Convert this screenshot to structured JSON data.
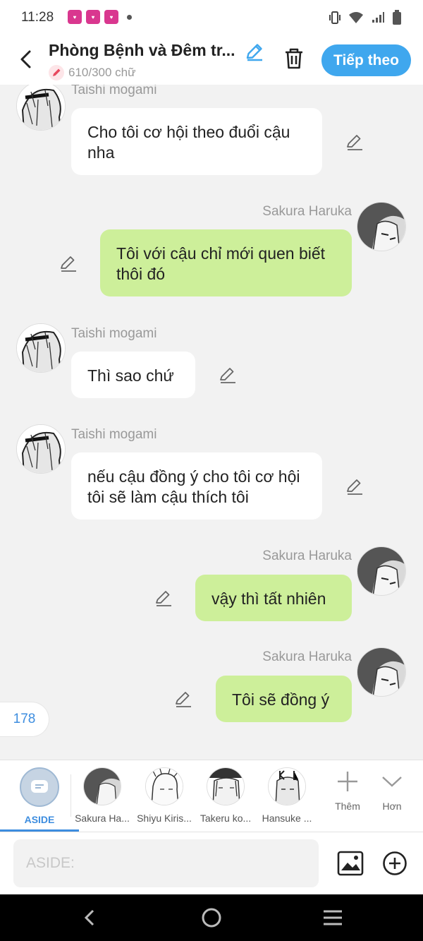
{
  "status_bar": {
    "time": "11:28",
    "notification_icons": [
      "app-notification-icon",
      "app-notification-icon",
      "app-notification-icon"
    ],
    "system_icons": [
      "vibrate-icon",
      "wifi-icon",
      "signal-icon",
      "battery-icon"
    ]
  },
  "header": {
    "title": "Phòng Bệnh và Đêm tr...",
    "word_count": "610/300 chữ",
    "next_label": "Tiếp theo",
    "accent_color": "#3fa7ee"
  },
  "messages": [
    {
      "sender": "Taishi mogami",
      "side": "left",
      "text": "Cho tôi cơ hội theo đuổi cậu nha"
    },
    {
      "sender": "Sakura Haruka",
      "side": "right",
      "text": "Tôi với cậu chỉ mới quen biết thôi đó"
    },
    {
      "sender": "Taishi mogami",
      "side": "left",
      "text": "Thì sao chứ"
    },
    {
      "sender": "Taishi mogami",
      "side": "left",
      "text": "nếu cậu đồng ý cho tôi cơ hội tôi sẽ làm cậu thích tôi"
    },
    {
      "sender": "Sakura Haruka",
      "side": "right",
      "text": "vậy thì tất nhiên"
    },
    {
      "sender": "Sakura Haruka",
      "side": "right",
      "text": "Tôi sẽ đồng ý"
    }
  ],
  "bubble_colors": {
    "left": "#ffffff",
    "right": "#cdef9a"
  },
  "message_count": "178",
  "characters": {
    "aside_label": "ASIDE",
    "items": [
      {
        "label": "Sakura Ha..."
      },
      {
        "label": "Shiyu Kiris..."
      },
      {
        "label": "Takeru ko..."
      },
      {
        "label": "Hansuke ..."
      }
    ],
    "add_label": "Thêm",
    "more_label": "Hơn"
  },
  "input": {
    "placeholder": "ASIDE:"
  }
}
